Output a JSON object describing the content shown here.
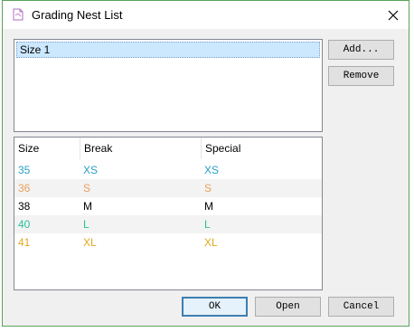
{
  "window": {
    "title": "Grading Nest List",
    "icon": "document-icon"
  },
  "size_list": {
    "items": [
      "Size 1"
    ],
    "selected": 0
  },
  "side_buttons": {
    "add": "Add...",
    "remove": "Remove"
  },
  "table": {
    "headers": [
      "Size",
      "Break",
      "Special"
    ],
    "rows": [
      {
        "size": "35",
        "break": "XS",
        "special": "XS",
        "color": "#2aa0c8"
      },
      {
        "size": "36",
        "break": "S",
        "special": "S",
        "color": "#e8a060"
      },
      {
        "size": "38",
        "break": "M",
        "special": "M",
        "color": "#000000"
      },
      {
        "size": "40",
        "break": "L",
        "special": "L",
        "color": "#2abf9a"
      },
      {
        "size": "41",
        "break": "XL",
        "special": "XL",
        "color": "#e0a820"
      }
    ]
  },
  "bottom_buttons": {
    "ok": "OK",
    "open": "Open",
    "cancel": "Cancel"
  }
}
